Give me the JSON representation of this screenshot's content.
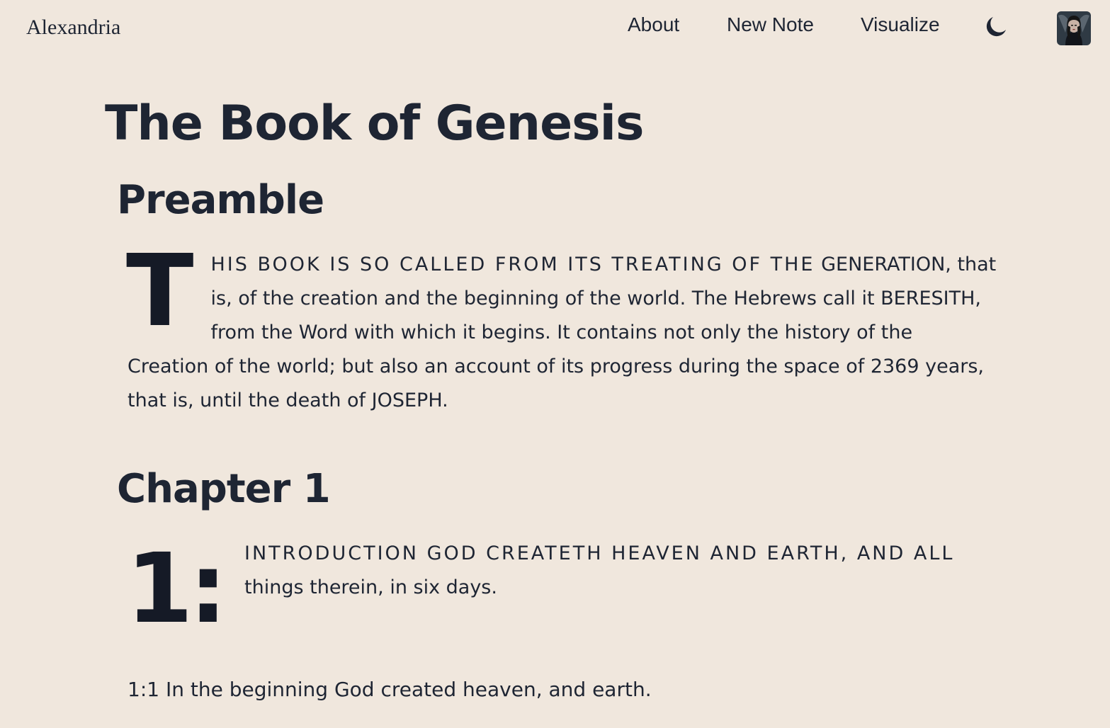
{
  "header": {
    "brand": "Alexandria",
    "nav": {
      "about": "About",
      "new_note": "New Note",
      "visualize": "Visualize"
    },
    "theme_toggle_icon": "moon-icon",
    "avatar_icon": "user-avatar"
  },
  "book": {
    "title": "The Book of Genesis"
  },
  "preamble": {
    "heading": "Preamble",
    "dropcap": "T",
    "lead": "HIS BOOK IS SO CALLED FROM ITS TREATING OF THE",
    "body": "GENERATION, that is, of the creation and the beginning of the world. The Hebrews call it BERESITH, from the Word with which it begins. It contains not only the history of the Creation of the world; but also an account of its progress during the space of 2369 years, that is, until the death of JOSEPH."
  },
  "chapter1": {
    "heading": "Chapter 1",
    "dropcap": "1:",
    "lead": "INTRODUCTION GOD CREATETH HEAVEN AND EARTH, AND ALL",
    "body": "things therein, in six days.",
    "verses": [
      "1:1 In the beginning God created heaven, and earth."
    ]
  },
  "colors": {
    "background": "#f0e7dd",
    "text": "#1e2533"
  }
}
